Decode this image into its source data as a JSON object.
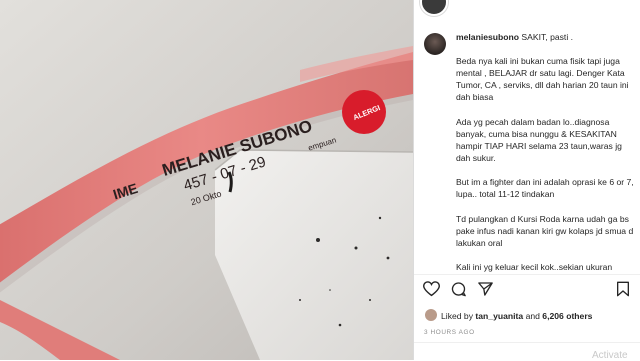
{
  "post": {
    "username": "melaniesubono",
    "caption_first": "SAKIT, pasti .",
    "caption_lines": [
      "Beda nya kali ini bukan cuma fisik tapi juga mental , BELAJAR dr satu lagi. Denger Kata Tumor, CA , serviks, dll dah harian 20 taun ini dah biasa",
      "Ada yg pecah dalam badan lo..diagnosa banyak, cuma bisa nunggu & KESAKITAN hampir TIAP HARI selama 23 taun,waras jg dah sukur.",
      "But im a fighter dan ini adalah oprasi ke 6 or 7, lupa.. total 11-12 tindakan",
      "Td pulangkan d Kursi Roda karna udah ga bs pake infus nadi kanan kiri gw kolaps jd smua d lakukan oral",
      "Kali ini yg keluar kecil kok..sekian ukuran"
    ],
    "likes_prefix": "Liked by",
    "liked_by_user": "tan_yuanita",
    "likes_and": "and",
    "likes_count": "6,206 others",
    "timestamp": "3 HOURS AGO"
  },
  "wristband": {
    "name": "MELANIE SUBONO",
    "dob": "457 - 07 - 29",
    "date_partial": "20 Okto",
    "label_partial": "IME",
    "allergy_label": "ALERGI",
    "side_text": "empuan"
  },
  "watermark": "Activate",
  "icons": [
    "heart-icon",
    "comment-icon",
    "share-icon",
    "bookmark-icon"
  ],
  "colors": {
    "wristband": "#e47f7c",
    "allergy_dot": "#d81c2b",
    "text": "#262626",
    "muted": "#8e8e8e"
  }
}
